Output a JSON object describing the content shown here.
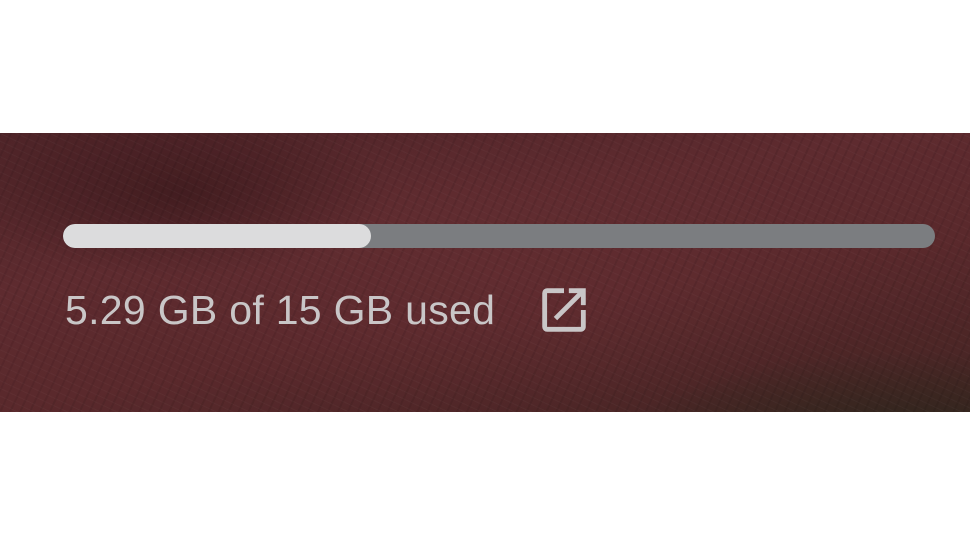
{
  "storage": {
    "usage_text": "5.29 GB of 15 GB used",
    "used_gb": 5.29,
    "total_gb": 15,
    "used_fraction": 0.3527,
    "open_icon": "open-in-new-icon"
  },
  "colors": {
    "bar_fill": "#dcdcdd",
    "bar_track": "#7b7d80",
    "text": "#c9c6c7"
  }
}
